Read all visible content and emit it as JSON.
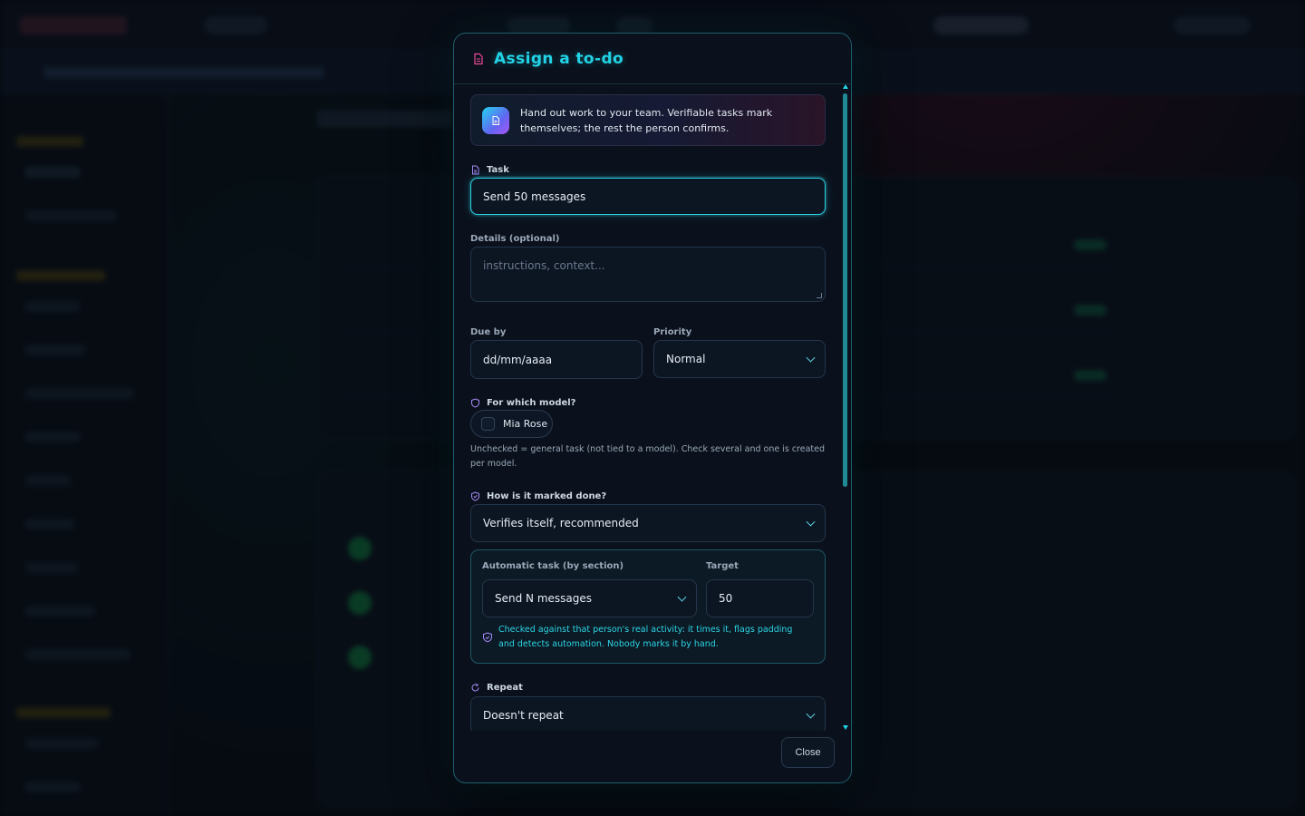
{
  "modal": {
    "title": "Assign a to-do",
    "info": "Hand out work to your team. Verifiable tasks mark themselves; the rest the person confirms.",
    "task": {
      "label": "Task",
      "value": "Send 50 messages"
    },
    "details": {
      "label": "Details (optional)",
      "placeholder": "instructions, context..."
    },
    "due": {
      "label": "Due by",
      "value": "dd/mm/aaaa"
    },
    "priority": {
      "label": "Priority",
      "value": "Normal"
    },
    "model": {
      "label": "For which model?",
      "option": "Mia Rose",
      "helper": "Unchecked = general task (not tied to a model). Check several and one is created per model."
    },
    "completion": {
      "label": "How is it marked done?",
      "value": "Verifies itself, recommended"
    },
    "automatic": {
      "label": "Automatic task (by section)",
      "value": "Send N messages",
      "target_label": "Target",
      "target_value": "50",
      "note": "Checked against that person's real activity: it times it, flags padding and detects automation. Nobody marks it by hand."
    },
    "repeat": {
      "label": "Repeat",
      "value": "Doesn't repeat"
    },
    "close_label": "Close"
  },
  "colors": {
    "accent": "#22d3e6",
    "modal_border": "#1f5e6a",
    "background": "#070b12"
  },
  "icons": {
    "title": "document-icon",
    "info": "document-gradient-icon",
    "model": "shield-icon",
    "completion": "shield-check-icon",
    "repeat": "refresh-icon"
  }
}
